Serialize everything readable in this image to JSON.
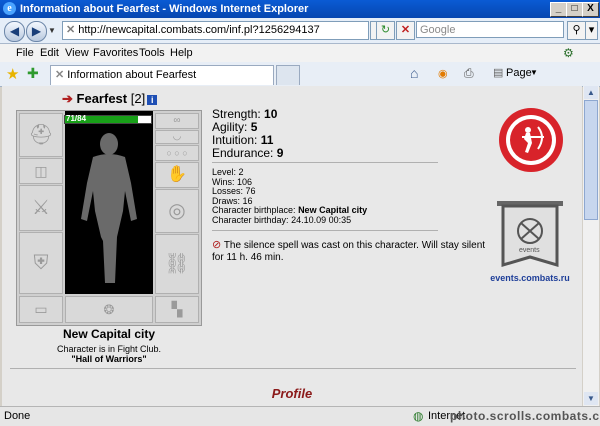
{
  "window": {
    "title": "Information about Fearfest - Windows Internet Explorer",
    "minimize": "_",
    "maximize": "□",
    "close": "X"
  },
  "address_bar": {
    "url": "http://newcapital.combats.com/inf.pl?1256294137",
    "search_placeholder": "Google"
  },
  "menu": [
    "File",
    "Edit",
    "View",
    "Favorites",
    "Tools",
    "Help"
  ],
  "tab": {
    "title": "Information about Fearfest"
  },
  "command_bar": {
    "page_label": "Page"
  },
  "character": {
    "name": "Fearfest",
    "level_badge": "[2]",
    "info_icon_label": "i",
    "hp_text": "71/84",
    "hp_fraction": 0.845,
    "stats": [
      {
        "label": "Strength:",
        "value": "10"
      },
      {
        "label": "Agility:",
        "value": "5"
      },
      {
        "label": "Intuition:",
        "value": "11"
      },
      {
        "label": "Endurance:",
        "value": "9"
      }
    ],
    "details": [
      {
        "label": "Level:",
        "value": "2",
        "bold": false
      },
      {
        "label": "Wins:",
        "value": "106",
        "bold": false
      },
      {
        "label": "Losses:",
        "value": "76",
        "bold": false
      },
      {
        "label": "Draws:",
        "value": "16",
        "bold": false
      },
      {
        "label": "Character birthplace:",
        "value": "New Capital city",
        "bold": true
      },
      {
        "label": "Character birthday:",
        "value": "24.10.09 00:35",
        "bold": false
      }
    ],
    "silence_message": "The silence spell was cast on this character. Will stay silent for 11 h. 46 min.",
    "city": "New Capital city",
    "club_line": "Character is in Fight Club.",
    "hall": "\"Hall of Warriors\""
  },
  "events_link": "events.combats.ru",
  "banner_text": "events",
  "profile_heading": "Profile",
  "status": {
    "left": "Done",
    "zone": "Internet",
    "watermark": "photo.scrolls.combats.com"
  },
  "colors": {
    "accent_red": "#d8232a",
    "profile_red": "#8b1a1a",
    "link_blue": "#1f3f99"
  }
}
